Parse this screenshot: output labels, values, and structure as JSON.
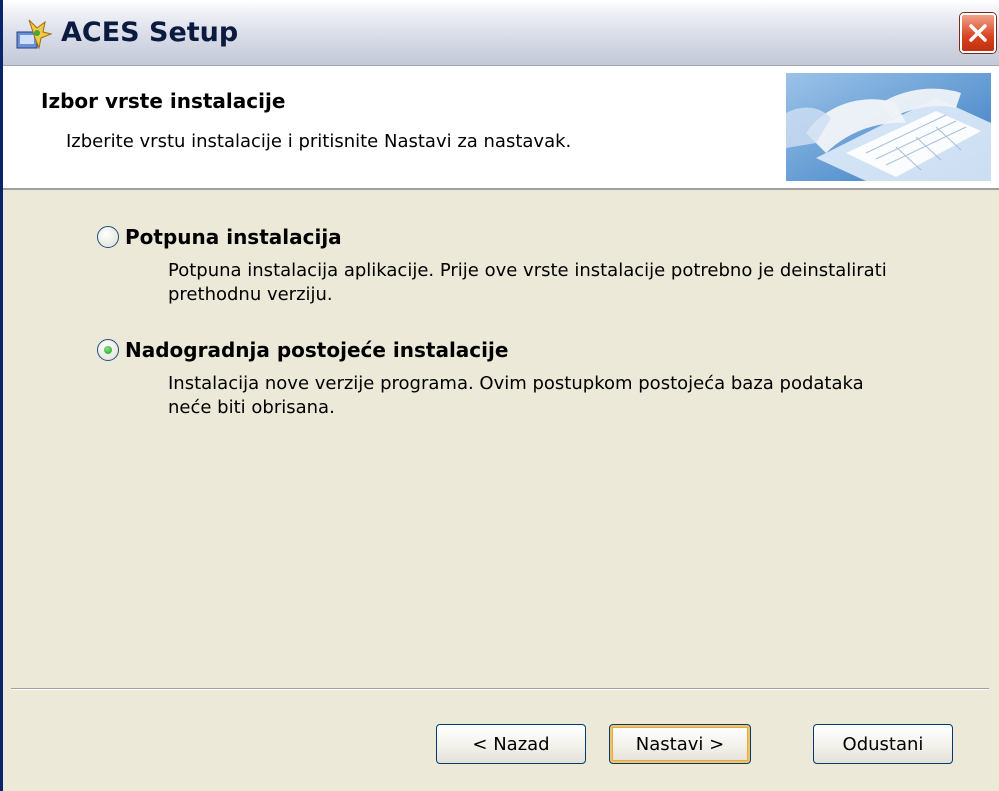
{
  "window": {
    "title": "ACES Setup",
    "title_icon": "setup-installer-icon",
    "close_icon": "close-icon"
  },
  "header": {
    "title": "Izbor vrste instalacije",
    "subtitle": "Izberite vrstu instalacije i pritisnite Nastavi za nastavak.",
    "banner_icon": "keyboard-typing-image"
  },
  "options": [
    {
      "label": "Potpuna instalacija",
      "description_line1": "Potpuna instalacija aplikacije. Prije ove vrste instalacije potrebno je deinstalirati",
      "description_line2": "prethodnu verziju.",
      "selected": false
    },
    {
      "label": "Nadogradnja postojeće instalacije",
      "description_line1": "Instalacija nove verzije programa. Ovim postupkom postojeća baza podataka",
      "description_line2": "neće biti obrisana.",
      "selected": true
    }
  ],
  "buttons": {
    "back": "< Nazad",
    "next": "Nastavi >",
    "cancel": "Odustani"
  },
  "colors": {
    "accent_selected": "#21a121",
    "close_button": "#d84320",
    "dialog_bg": "#ece9d8"
  }
}
